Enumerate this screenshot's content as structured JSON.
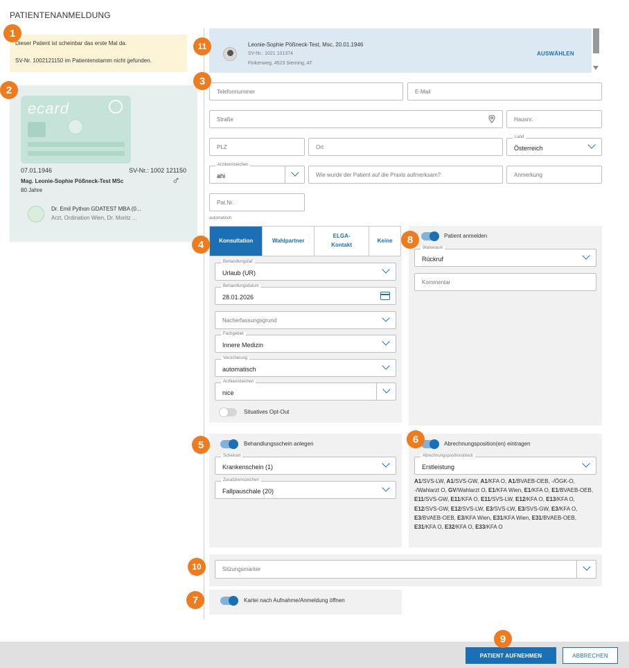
{
  "page_title": "PATIENTENANMELDUNG",
  "badges": [
    "1",
    "2",
    "3",
    "4",
    "5",
    "6",
    "7",
    "8",
    "9",
    "10",
    "11"
  ],
  "warning": {
    "line1": "Dieser Patient ist scheinbar das erste Mal da.",
    "line2": "SV-Nr. 1002121150 im Patientenstamm nicht gefunden."
  },
  "ecard": {
    "logo": "ecard",
    "dob": "07.01.1946",
    "sv": "SV-Nr.: 1002 121150",
    "name": "Mag. Leonie-Sophie Pößneck-Test MSc",
    "age": "80 Jahre",
    "gender_symbol": "♂",
    "doctor_name": "Dr. Emil Python GDATEST MBA (0...",
    "doctor_sub": "Arzt, Ordination Wien, Dr. Moritz ..."
  },
  "suggestion": {
    "name_prefix": "Leonie-Sophie Pößneck-Test, Msc,",
    "dob": " 20.01.1946",
    "sv": "SV-Nr.: 1021 101374",
    "address": "Finkenweg, 4523 Sierning, AT",
    "select_label": "AUSWÄHLEN"
  },
  "form": {
    "phone_ph": "Telefonnummer",
    "email_ph": "E-Mail",
    "street_ph": "Straße",
    "house_ph": "Hausnr.",
    "zip_ph": "PLZ",
    "city_ph": "Ort",
    "country_label": "Land",
    "country_value": "Österreich",
    "doctor_code_label": "Arztkennzeichen",
    "doctor_code_value": "ahi",
    "referral_ph": "Wie wurde der Patient auf die Praxis aufmerksam?",
    "remark_ph": "Anmerkung",
    "pat_nr_ph": "Pat.Nr.",
    "auto_note": "automatisch"
  },
  "tabs": [
    {
      "label": "Konsultation",
      "active": true
    },
    {
      "label": "Wahlpartner",
      "active": false
    },
    {
      "label": "ELGA-\nKontakt",
      "active": false
    },
    {
      "label": "Keine",
      "active": false
    }
  ],
  "consult": {
    "case_label": "Behandlungsfall",
    "case_value": "Urlaub (UR)",
    "date_label": "Behandlungsdatum",
    "date_value": "28.01.2026",
    "followup_ph": "Nacherfassungsgrund",
    "field_label": "Fachgebiet",
    "field_value": "Innere Medizin",
    "insurance_label": "Versicherung",
    "insurance_value": "automatisch",
    "code_label": "Arztkennzeichen",
    "code_value": "nice",
    "optout_label": "Situatives Opt-Out"
  },
  "register": {
    "toggle_label": "Patient anmelden",
    "room_label": "Warteraum",
    "room_value": "Rückruf",
    "comment_ph": "Kommentar"
  },
  "treatment": {
    "toggle_label": "Behandlungsschein anlegen",
    "type_label": "Scheinart",
    "type_value": "Krankenschein (1)",
    "extra_label": "Zusatzkennzeichen",
    "extra_value": "Fallpauschale (20)"
  },
  "billing": {
    "toggle_label": "Abrechnungsposition(en) eintragen",
    "block_label": "Abrechnungspositionsblock",
    "block_value": "Erstleistung",
    "codes": [
      [
        "A1",
        "/SVS-LW, "
      ],
      [
        "A1",
        "/SVS-GW, "
      ],
      [
        "A1",
        "/KFA O, "
      ],
      [
        "A1",
        "/BVAEB-OEB, -/ÖGK-O, -/Wahlarzt O, "
      ],
      [
        "GV",
        "/Wahlarzt O, "
      ],
      [
        "E1",
        "/KFA Wien, "
      ],
      [
        "E1",
        "/KFA O, "
      ],
      [
        "E1",
        "/BVAEB-OEB, "
      ],
      [
        "E11",
        "/SVS-GW, "
      ],
      [
        "E11",
        "/KFA O, "
      ],
      [
        "E11",
        "/SVS-LW, "
      ],
      [
        "E12",
        "/KFA O, "
      ],
      [
        "E13",
        "/KFA O, "
      ],
      [
        "E12",
        "/SVS-GW, "
      ],
      [
        "E12",
        "/SVS-LW, "
      ],
      [
        "E3",
        "/SVS-LW, "
      ],
      [
        "E3",
        "/SVS-GW, "
      ],
      [
        "E3",
        "/KFA O, "
      ],
      [
        "E3",
        "/BVAEB-OEB, "
      ],
      [
        "E3",
        "/KFA Wien, "
      ],
      [
        "E31",
        "/KFA Wien, "
      ],
      [
        "E31",
        "/BVAEB-OEB, "
      ],
      [
        "E31",
        "/KFA O, "
      ],
      [
        "E32",
        "/KFA O, "
      ],
      [
        "E33",
        "/KFA O"
      ]
    ]
  },
  "session": {
    "placeholder": "Sitzungsmarker"
  },
  "kartei": {
    "toggle_label": "Kartei nach Aufnahme/Anmeldung öffnen"
  },
  "footer": {
    "primary_label": "PATIENT AUFNEHMEN",
    "secondary_label": "ABBRECHEN"
  },
  "colors": {
    "accent": "#1a6fb5",
    "badge": "#ee7b1e",
    "warning_bg": "#fdf4d8"
  }
}
